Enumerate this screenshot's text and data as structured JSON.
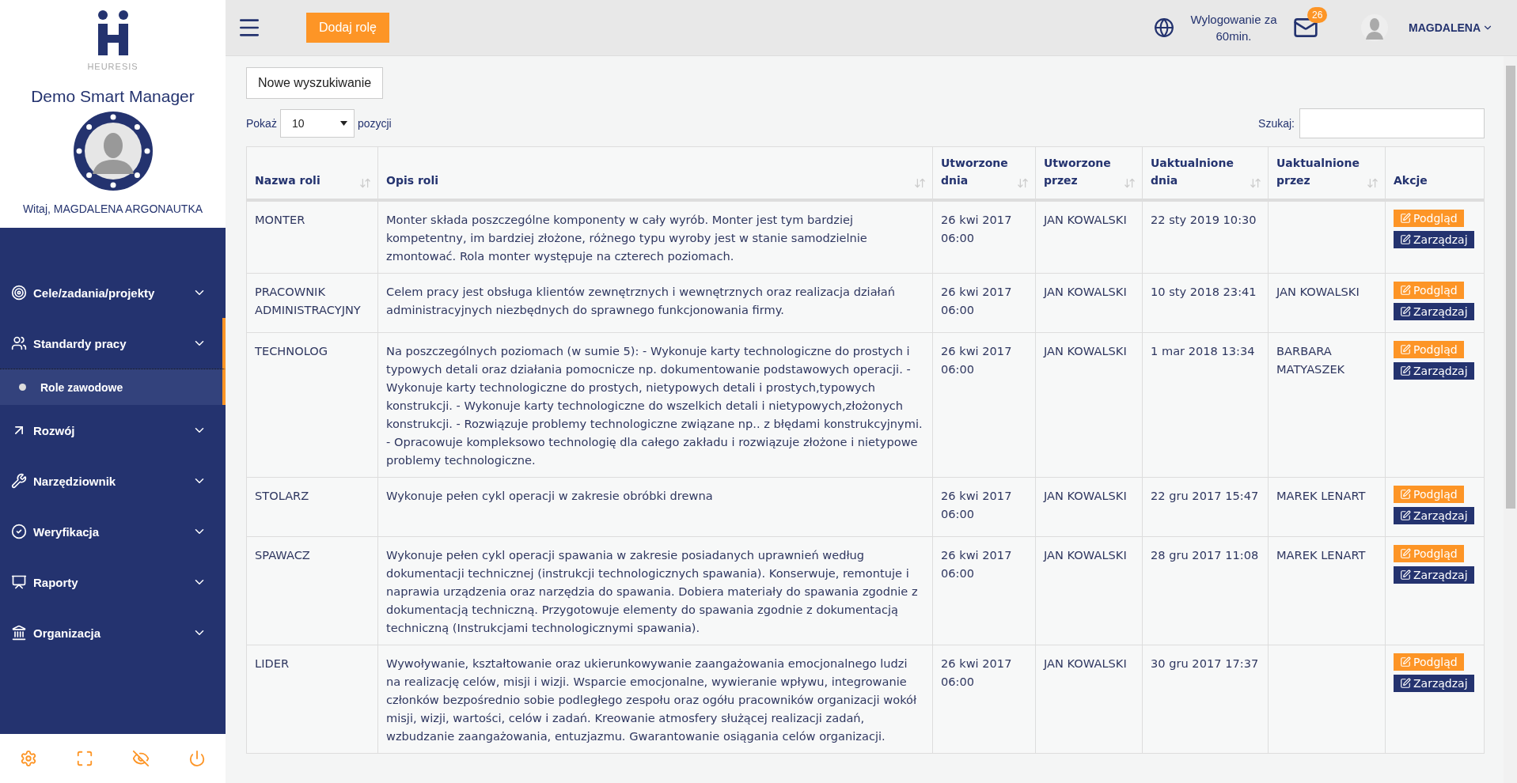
{
  "sidebar": {
    "logo_text": "HEURESIS",
    "app_title": "Demo Smart Manager",
    "greeting": "Witaj, MAGDALENA ARGONAUTKA",
    "items": [
      {
        "label": "Cele/zadania/projekty",
        "selected": false
      },
      {
        "label": "Standardy pracy",
        "selected": true,
        "children": [
          {
            "label": "Role zawodowe",
            "selected": true
          }
        ]
      },
      {
        "label": "Rozwój",
        "selected": false
      },
      {
        "label": "Narzędziownik",
        "selected": false
      },
      {
        "label": "Weryfikacja",
        "selected": false
      },
      {
        "label": "Raporty",
        "selected": false
      },
      {
        "label": "Organizacja",
        "selected": false
      }
    ]
  },
  "topbar": {
    "add_button": "Dodaj rolę",
    "logout_notice": "Wylogowanie za 60min.",
    "messages_count": "26",
    "user_name": "MAGDALENA"
  },
  "new_search_button": "Nowe wyszukiwanie",
  "length": {
    "prefix": "Pokaż",
    "value": "10",
    "suffix": "pozycji"
  },
  "search": {
    "label": "Szukaj:"
  },
  "table": {
    "columns": [
      {
        "label": "Nazwa roli",
        "sortable": true
      },
      {
        "label": "Opis roli",
        "sortable": true
      },
      {
        "label": "Utworzone dnia",
        "sortable": true
      },
      {
        "label": "Utworzone przez",
        "sortable": true
      },
      {
        "label": "Uaktualnione dnia",
        "sortable": true
      },
      {
        "label": "Uaktualnione przez",
        "sortable": true
      },
      {
        "label": "Akcje",
        "sortable": false
      }
    ],
    "rows": [
      {
        "name": "MONTER",
        "description": "Monter składa poszczególne komponenty w cały wyrób. Monter jest tym bardziej kompetentny, im bardziej złożone, różnego typu wyroby jest w stanie samodzielnie zmontować. Rola monter występuje na czterech poziomach.",
        "created": "26 kwi 2017 06:00",
        "created_by": "JAN KOWALSKI",
        "updated": "22 sty 2019 10:30",
        "updated_by": "",
        "actions": [
          "Podgląd",
          "Zarządzaj"
        ]
      },
      {
        "name": "PRACOWNIK ADMINISTRACYJNY",
        "description": "Celem pracy jest obsługa klientów zewnętrznych i wewnętrznych oraz realizacja działań administracyjnych niezbędnych do sprawnego funkcjonowania firmy.",
        "created": "26 kwi 2017 06:00",
        "created_by": "JAN KOWALSKI",
        "updated": "10 sty 2018 23:41",
        "updated_by": "JAN KOWALSKI",
        "actions": [
          "Podgląd",
          "Zarządzaj"
        ]
      },
      {
        "name": "TECHNOLOG",
        "description": "Na poszczególnych poziomach (w sumie 5): - Wykonuje karty technologiczne do prostych i typowych detali oraz działania pomocnicze np. dokumentowanie podstawowych operacji. - Wykonuje karty technologiczne do prostych, nietypowych detali i prostych,typowych konstrukcji. - Wykonuje karty technologiczne do wszelkich detali i nietypowych,złożonych konstrukcji. - Rozwiązuje problemy technologiczne związane np.. z błędami konstrukcyjnymi. - Opracowuje kompleksowo technologię dla całego zakładu i rozwiązuje złożone i nietypowe problemy technologiczne.",
        "created": "26 kwi 2017 06:00",
        "created_by": "JAN KOWALSKI",
        "updated": "1 mar 2018 13:34",
        "updated_by": "BARBARA MATYASZEK",
        "actions": [
          "Podgląd",
          "Zarządzaj"
        ]
      },
      {
        "name": "STOLARZ",
        "description": "Wykonuje pełen cykl operacji w zakresie obróbki drewna",
        "created": "26 kwi 2017 06:00",
        "created_by": "JAN KOWALSKI",
        "updated": "22 gru 2017 15:47",
        "updated_by": "MAREK LENART",
        "actions": [
          "Podgląd",
          "Zarządzaj"
        ]
      },
      {
        "name": "SPAWACZ",
        "description": "Wykonuje pełen cykl operacji spawania w zakresie posiadanych uprawnień według dokumentacji technicznej (instrukcji technologicznych spawania). Konserwuje, remontuje i naprawia urządzenia oraz narzędzia do spawania. Dobiera materiały do spawania zgodnie z dokumentacją techniczną. Przygotowuje elementy do spawania zgodnie z dokumentacją techniczną (Instrukcjami technologicznymi spawania).",
        "created": "26 kwi 2017 06:00",
        "created_by": "JAN KOWALSKI",
        "updated": "28 gru 2017 11:08",
        "updated_by": "MAREK LENART",
        "actions": [
          "Podgląd",
          "Zarządzaj"
        ]
      },
      {
        "name": "LIDER",
        "description": "Wywoływanie, kształtowanie oraz ukierunkowywanie zaangażowania emocjonalnego ludzi na realizację celów, misji i wizji. Wsparcie emocjonalne, wywieranie wpływu, integrowanie członków bezpośrednio sobie podległego zespołu oraz ogółu pracowników organizacji wokół misji, wizji, wartości, celów i zadań. Kreowanie atmosfery służącej realizacji zadań, wzbudzanie zaangażowania, entuzjazmu. Gwarantowanie osiągania celów organizacji.",
        "created": "26 kwi 2017 06:00",
        "created_by": "JAN KOWALSKI",
        "updated": "30 gru 2017 17:37",
        "updated_by": "",
        "actions": [
          "Podgląd",
          "Zarządzaj"
        ]
      }
    ]
  }
}
